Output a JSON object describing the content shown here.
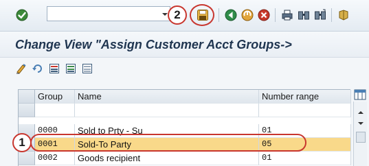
{
  "toolbar": {
    "command_field_value": "",
    "icons": [
      "ok-check-icon",
      "save-icon",
      "back-icon",
      "exit-icon",
      "cancel-icon",
      "print-icon",
      "find-icon",
      "find-next-icon",
      "layout-icon"
    ]
  },
  "callouts": {
    "step1": "1",
    "step2": "2"
  },
  "title": "Change View \"Assign Customer Acct Groups->",
  "app_toolbar": {
    "icons": [
      "display-change-icon",
      "undo-icon",
      "select-all-icon",
      "select-block-icon",
      "deselect-all-icon"
    ]
  },
  "table": {
    "columns": [
      "Group",
      "Name",
      "Number range"
    ],
    "rows": [
      {
        "group": "",
        "name": "",
        "range": ""
      },
      {
        "group": "0000",
        "name": "Sold to Prty - Su",
        "range": "01"
      },
      {
        "group": "0001",
        "name": "Sold-To Party",
        "range": "05"
      },
      {
        "group": "0002",
        "name": "Goods recipient",
        "range": "01"
      }
    ],
    "highlighted_row_index": 2
  },
  "colors": {
    "callout_red": "#c8362e",
    "highlight": "#f9d98a",
    "title_text": "#1f3550"
  }
}
